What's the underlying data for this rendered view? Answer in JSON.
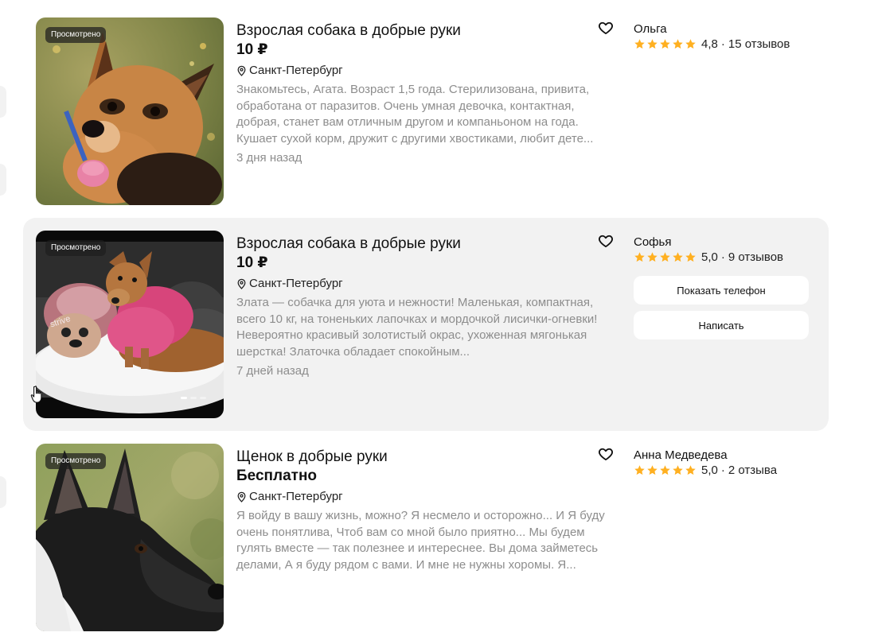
{
  "listings": [
    {
      "title": "Взрослая собака в добрые руки",
      "price": "10 ₽",
      "location": "Санкт-Петербург",
      "description": "Знакомьтесь, Агата. Возраст 1,5 года. Стерилизована, привита, обработана от паразитов. Очень умная девочка, контактная, добрая, станет вам отличным другом и компаньоном на года. Кушает сухой корм, дружит с другими хвостиками, любит дете...",
      "date": "3 дня назад",
      "badge": "Просмотрено",
      "seller": {
        "name": "Ольга",
        "rating": "4,8",
        "reviews": "15 отзывов"
      }
    },
    {
      "title": "Взрослая собака в добрые руки",
      "price": "10 ₽",
      "location": "Санкт-Петербург",
      "description": "Злата — собачка для уюта и нежности! Маленькая, компактная, всего 10 кг, на тоненьких лапочках и мордочкой лисички-огневки! Невероятно красивый золотистый окрас, ухоженная мягонькая шерстка! Златочка обладает спокойным...",
      "date": "7 дней назад",
      "badge": "Просмотрено",
      "seller": {
        "name": "Софья",
        "rating": "5,0",
        "reviews": "9 отзывов"
      },
      "buttons": {
        "phone": "Показать телефон",
        "message": "Написать"
      }
    },
    {
      "title": "Щенок в добрые руки",
      "price": "Бесплатно",
      "location": "Санкт-Петербург",
      "description": "Я войду в вашу жизнь, можно? Я несмело и осторожно... И Я буду очень понятлива, Чтоб вам со мной было приятно... Мы будем гулять вместе — так полезнее и интереснее. Вы дома займетесь делами, А я буду рядом с вами. И мне не нужны хоромы. Я...",
      "date": "",
      "badge": "Просмотрено",
      "seller": {
        "name": "Анна Медведева",
        "rating": "5,0",
        "reviews": "2 отзыва"
      }
    }
  ],
  "icons": {
    "favorite": "heart-outline-icon",
    "location": "map-pin-icon",
    "rating": "star-icon",
    "cursor": "hand-pointer-icon"
  },
  "colors": {
    "star": "#ffb021",
    "muted_text": "#8d8d8d",
    "hover_bg": "#f2f2f2",
    "badge_bg": "#1e1e1e"
  }
}
